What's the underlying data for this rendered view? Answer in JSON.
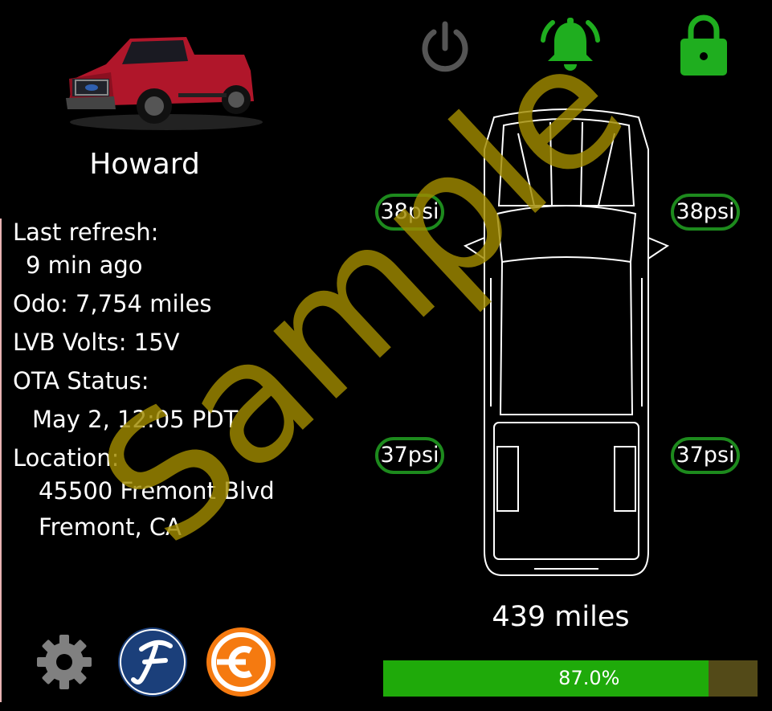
{
  "vehicle": {
    "name": "Howard",
    "image_icon": "red-pickup-truck-image"
  },
  "info": {
    "last_refresh_label": "Last refresh:",
    "last_refresh_value": "9 min ago",
    "odo": "Odo: 7,754 miles",
    "lvb": "LVB Volts: 15V",
    "ota_label": "OTA Status:",
    "ota_value": "May 2, 12:05 PDT",
    "location_label": "Location:",
    "address_line1": "45500 Fremont Blvd",
    "address_line2": "Fremont, CA"
  },
  "controls": {
    "power_icon": "power-icon",
    "alarm_icon": "bell-icon",
    "lock_icon": "lock-icon",
    "power_color": "#555555",
    "alarm_color": "#1fae1f",
    "lock_color": "#1fae1f"
  },
  "tires": {
    "front_left": "38psi",
    "front_right": "38psi",
    "rear_left": "37psi",
    "rear_right": "37psi",
    "ring_color": "#1d8a1d"
  },
  "range": {
    "text": "439 miles",
    "percent_label": "87.0%",
    "percent": 87.0,
    "fill_color": "#1faa0a",
    "empty_color": "#534a18"
  },
  "bottom_icons": {
    "settings": "gear-icon",
    "ford": "ford-script-logo",
    "charge": "charge-logo"
  },
  "watermark": "Sample"
}
